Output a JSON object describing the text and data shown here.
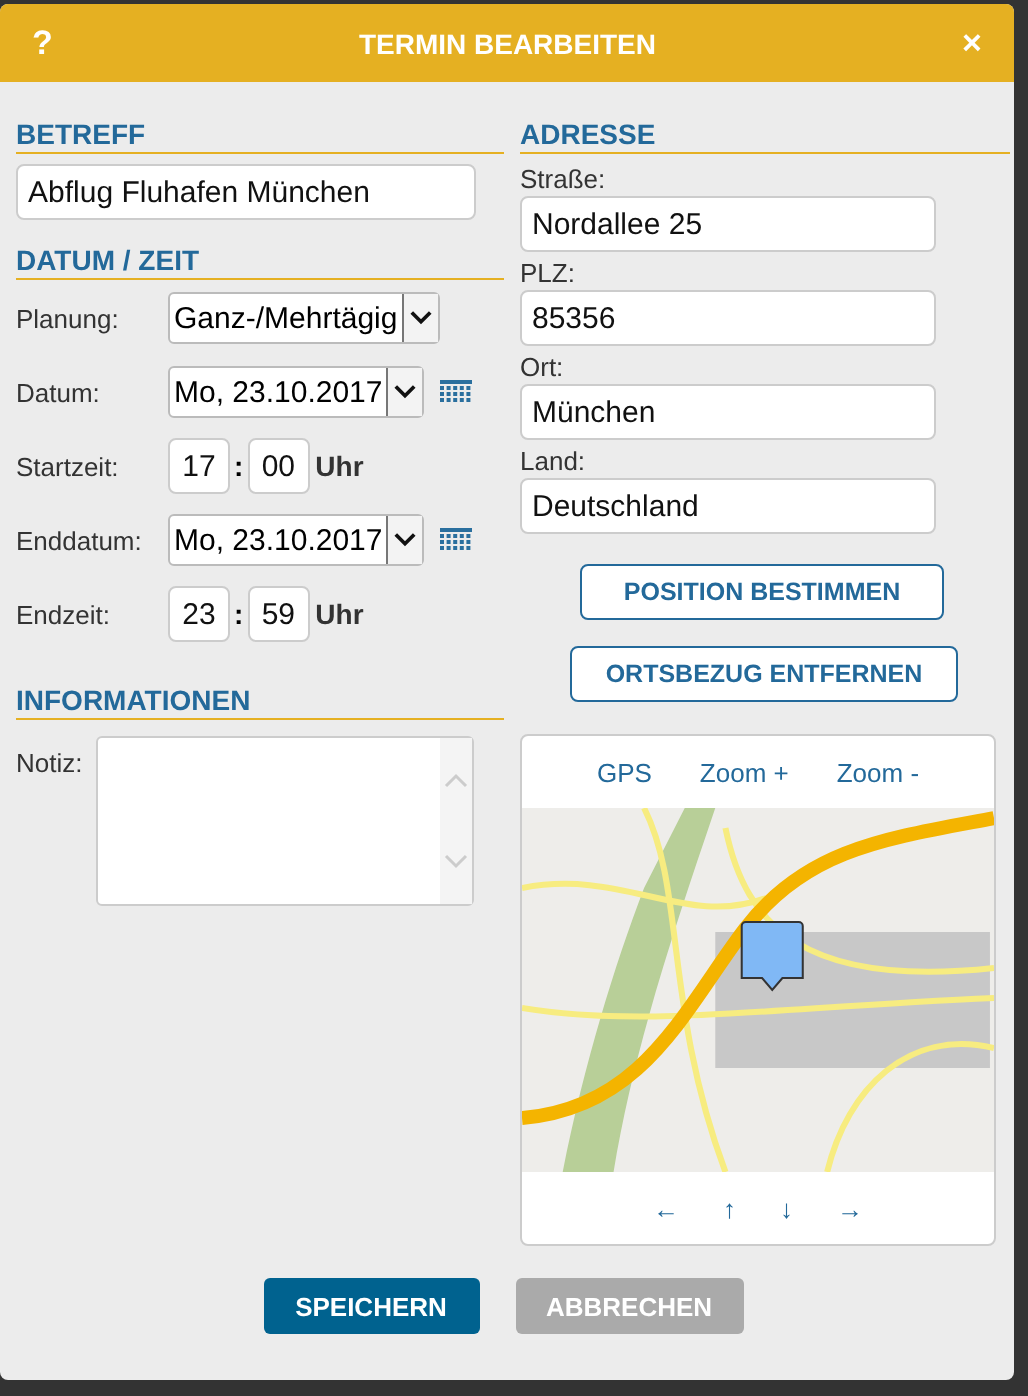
{
  "window": {
    "help": "?",
    "title": "TERMIN BEARBEITEN",
    "close": "×"
  },
  "betreff": {
    "heading": "BETREFF",
    "value": "Abflug Fluhafen München"
  },
  "datum_zeit": {
    "heading": "DATUM / ZEIT",
    "rows": [
      {
        "kind": "select",
        "label": "Planung:",
        "value": "Ganz-/Mehrtägig"
      },
      {
        "kind": "date",
        "label": "Datum:",
        "value": "Mo, 23.10.2017"
      },
      {
        "kind": "time",
        "label": "Startzeit:",
        "hour": "17",
        "sep": ":",
        "minute": "00",
        "unit": "Uhr"
      },
      {
        "kind": "date",
        "label": "Enddatum:",
        "value": "Mo, 23.10.2017"
      },
      {
        "kind": "time",
        "label": "Endzeit:",
        "hour": "23",
        "sep": ":",
        "minute": "59",
        "unit": "Uhr"
      }
    ]
  },
  "informationen": {
    "heading": "INFORMATIONEN",
    "label": "Notiz:"
  },
  "adresse": {
    "heading": "ADRESSE",
    "fields": [
      {
        "label": "Straße:",
        "value": "Nordallee 25"
      },
      {
        "label": "PLZ:",
        "value": "85356"
      },
      {
        "label": "Ort:",
        "value": "München"
      },
      {
        "label": "Land:",
        "value": "Deutschland"
      }
    ],
    "buttons": [
      "POSITION BESTIMMEN",
      "ORTSBEZUG ENTFERNEN"
    ]
  },
  "map": {
    "tools": [
      "GPS",
      "Zoom +",
      "Zoom -"
    ],
    "nav": [
      "←",
      "↑",
      "↓",
      "→"
    ]
  },
  "buttons": [
    {
      "label": "SPEICHERN",
      "kind": "primary"
    },
    {
      "label": "ABBRECHEN",
      "kind": "secondary"
    }
  ]
}
